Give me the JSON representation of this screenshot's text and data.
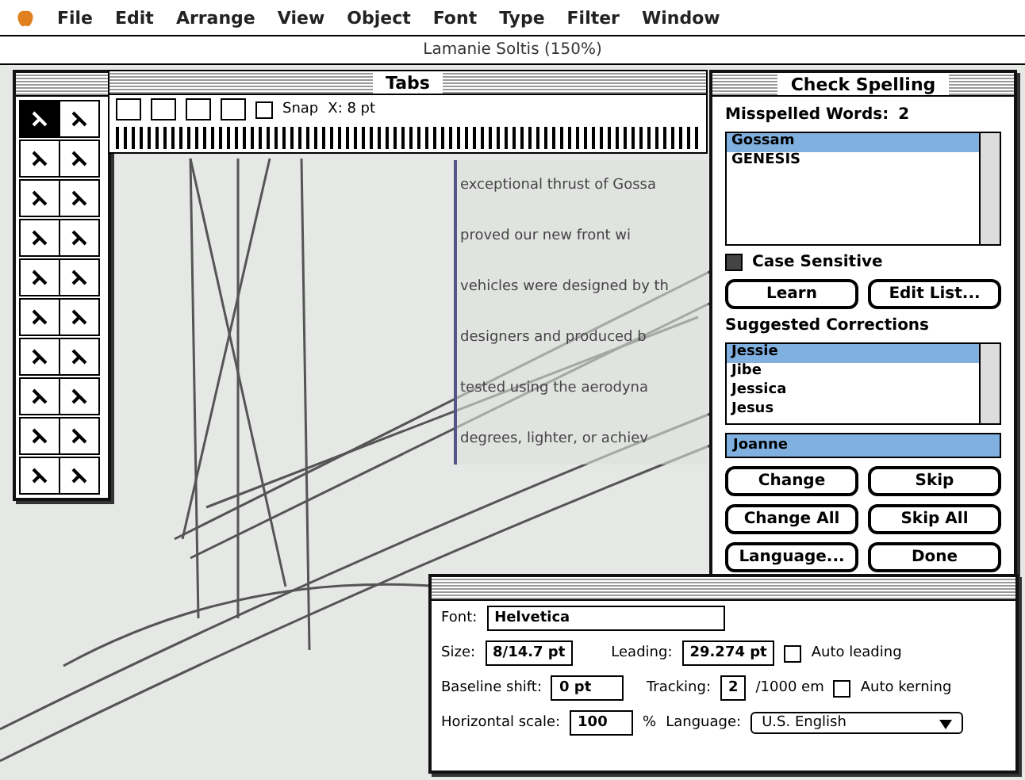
{
  "menu_bar": {
    "items": [
      "File",
      "Edit",
      "Arrange",
      "View",
      "Object",
      "Font",
      "Type",
      "Filter",
      "Window"
    ]
  },
  "document": {
    "title": "Lamanie Soltis (150%)",
    "text_lines": [
      "exceptional thrust of Gossa",
      "proved our new front wi",
      "vehicles were designed by th",
      "designers and produced b",
      "tested using the aerodyna",
      "degrees, lighter, or achiev"
    ]
  },
  "tabs_palette": {
    "title": "Tabs",
    "snap": {
      "label": "Snap",
      "checked": false
    },
    "position": "X: 8 pt"
  },
  "spelling": {
    "title": "Check Spelling",
    "misspelled_label": "Misspelled Words:",
    "misspelled_count": "2",
    "misspelled": [
      {
        "word": "Gossam",
        "selected": true
      },
      {
        "word": "GENESIS",
        "selected": false
      }
    ],
    "case_sensitive": {
      "label": "Case Sensitive",
      "checked": true
    },
    "learn": "Learn",
    "edit_list": "Edit List...",
    "suggested_label": "Suggested Corrections",
    "suggestions": [
      {
        "word": "Jessie",
        "selected": true
      },
      {
        "word": "Jibe",
        "selected": false
      },
      {
        "word": "Jessica",
        "selected": false
      },
      {
        "word": "Jesus",
        "selected": false
      }
    ],
    "replacement": "Joanne",
    "buttons": [
      "Change",
      "Skip",
      "Change All",
      "Skip All",
      "Language...",
      "Done"
    ]
  },
  "character": {
    "font_label": "Font:",
    "font": "Helvetica",
    "size_label": "Size:",
    "size": "8/14.7 pt",
    "leading_label": "Leading:",
    "leading": "29.274 pt",
    "auto_leading": {
      "label": "Auto leading",
      "checked": false
    },
    "baseline_label": "Baseline shift:",
    "baseline": "0 pt",
    "tracking_label": "Tracking:",
    "tracking": "2",
    "tracking_unit": "/1000 em",
    "auto_kerning": {
      "label": "Auto kerning",
      "checked": false
    },
    "scale_label": "Horizontal scale:",
    "scale": "100",
    "scale_unit": "%",
    "language_label": "Language:",
    "language": "U.S. English"
  }
}
